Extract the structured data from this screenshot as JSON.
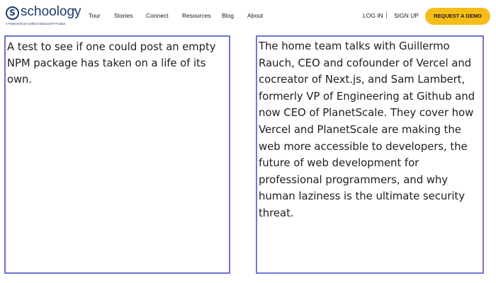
{
  "brand": {
    "logo_mark": "S",
    "logo_text": "schoology",
    "logo_tm": "®",
    "logo_subtitle": "A PowerSchool Unified Classroom® Product"
  },
  "nav": {
    "links": [
      {
        "label": "Tour"
      },
      {
        "label": "Stories"
      },
      {
        "label": "Connect"
      },
      {
        "label": "Resources"
      },
      {
        "label": "Blog"
      },
      {
        "label": "About"
      }
    ],
    "login_label": "LOG IN",
    "signup_label": "SIGN UP",
    "demo_label": "REQUEST A DEMO"
  },
  "colors": {
    "brand_blue": "#1f3b6e",
    "cta_yellow": "#f5bd17",
    "panel_border": "#6a73cf"
  },
  "panels": {
    "left_text": "A test to see if one could post an empty NPM package has taken on a life of its own.",
    "right_text": "The home team talks with Guillermo Rauch, CEO and cofounder of Vercel and cocreator of Next.js, and Sam Lambert, formerly VP of Engineering at Github and now CEO of PlanetScale. They cover how Vercel and PlanetScale are making the web more accessible to developers, the future of web development for professional programmers, and why human laziness is the ultimate security threat."
  }
}
